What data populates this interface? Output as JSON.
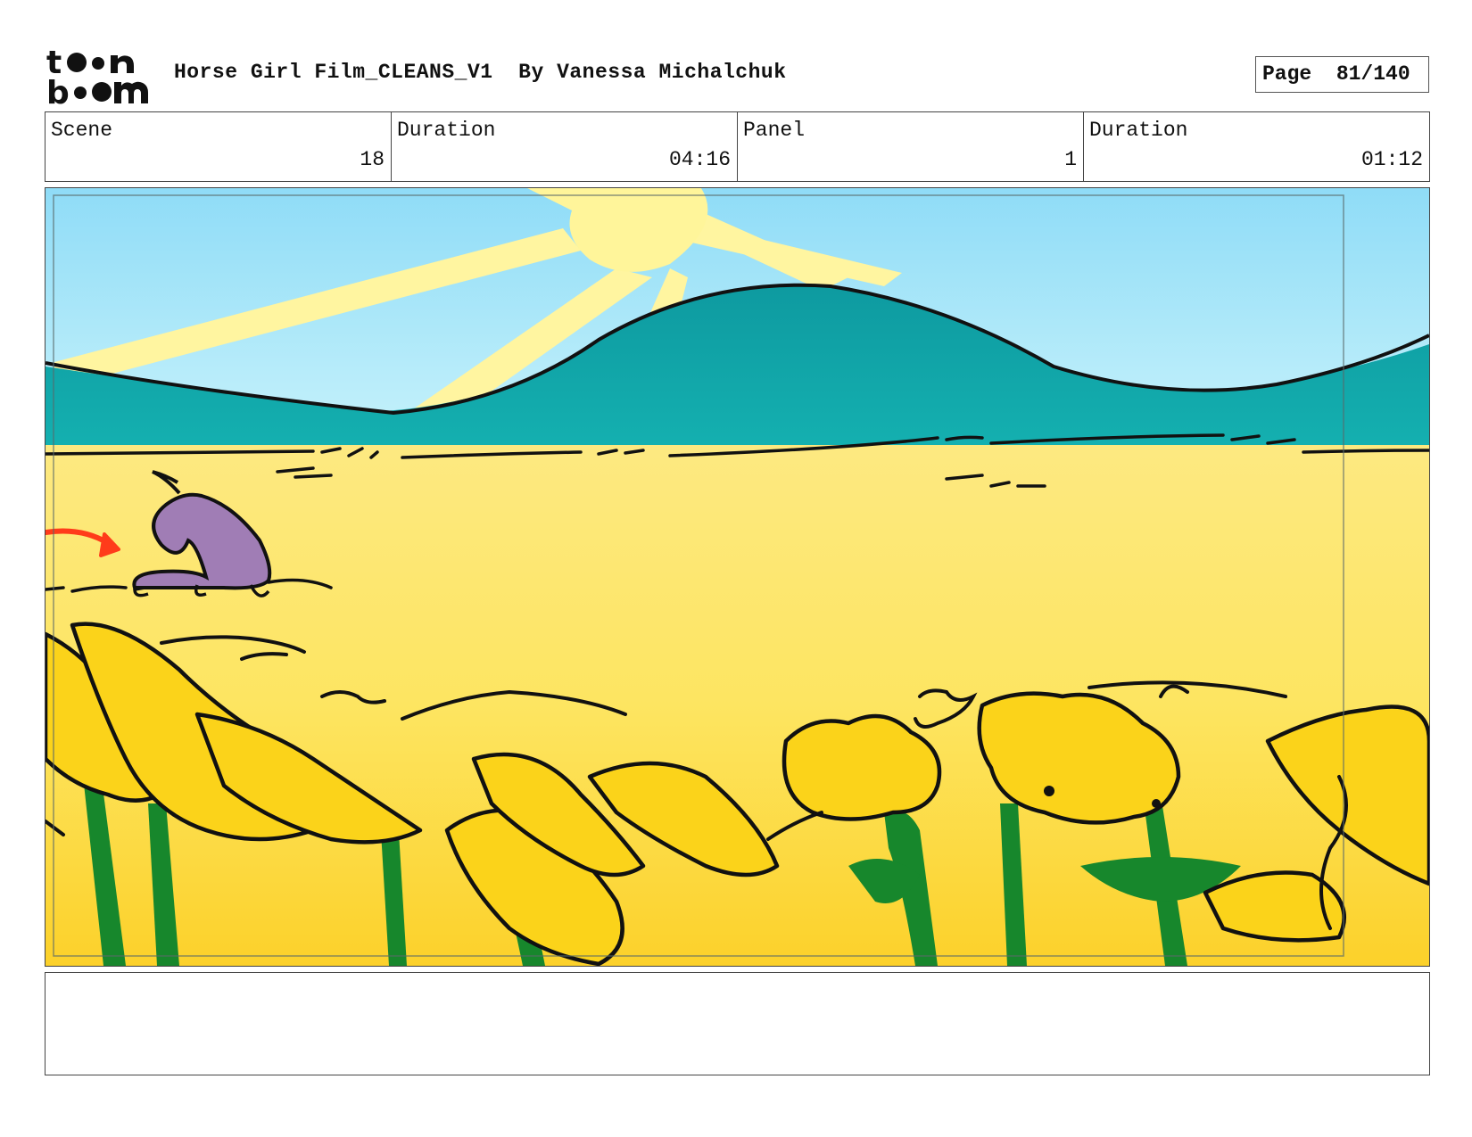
{
  "header": {
    "logo_top": "t",
    "logo_bottom": "b",
    "title": "Horse Girl Film_CLEANS_V1",
    "author": "By Vanessa Michalchuk",
    "page_label": "Page",
    "page_value": "81/140"
  },
  "info": {
    "scene_label": "Scene",
    "scene_value": "18",
    "duration_label": "Duration",
    "duration_value": "04:16",
    "panel_label": "Panel",
    "panel_value": "1",
    "panel_duration_label": "Duration",
    "panel_duration_value": "01:12"
  },
  "panel_art": {
    "description_colors": {
      "sky": "#a8e6f7",
      "sun": "#fff59a",
      "hills": "#10a3a3",
      "field": "#fde46a",
      "flowers": "#fbd31a",
      "stems": "#17872c",
      "horse": "#a07db5",
      "arrow": "#ff3b1a"
    }
  },
  "notes": {
    "text": ""
  }
}
